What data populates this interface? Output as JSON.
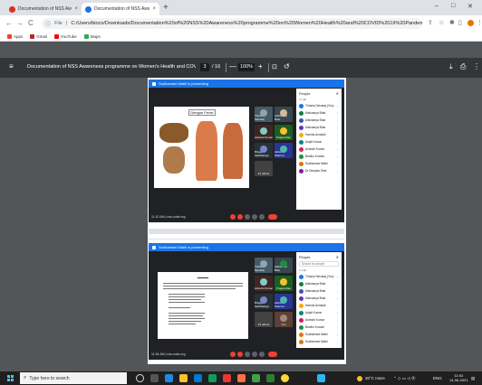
{
  "browser": {
    "tabs": [
      {
        "title": "Documentation of NSS Awarene",
        "favicon_color": "#d93025"
      },
      {
        "title": "Documentation of NSS Awaren",
        "favicon_color": "#1a73e8"
      }
    ],
    "new_tab": "+",
    "window_controls": {
      "minimize": "–",
      "maximize": "□",
      "close": "✕"
    },
    "nav": {
      "back": "←",
      "forward": "→",
      "reload": "C"
    },
    "address": {
      "scheme": "File",
      "url": "C:/Users/bioco/Downloads/Documentation%20of%20NSS%20Awareness%20programme%20on%20Women%20Health%20and%20COVID%2019%20Pandemic.pdf"
    },
    "bookmarks": [
      {
        "label": "Apps",
        "color": "#ea4335"
      },
      {
        "label": "Gmail",
        "color": "#c5221f"
      },
      {
        "label": "YouTube",
        "color": "#ff0000"
      },
      {
        "label": "Maps",
        "color": "#34a853"
      }
    ]
  },
  "pdf_viewer": {
    "title": "Documentation of NSS Awareness programme on Women's Health and COVID 19 Pa...",
    "current_page": "3",
    "total_pages": "/ 16",
    "zoom": "100%",
    "zoom_out": "—",
    "zoom_in": "+"
  },
  "page_content": {
    "shot1": {
      "presenting": "Sudhamani Mathi is presenting",
      "slide_title": "Dengue Fever",
      "meeting_time": "11:10 AM | nss-xoke-nrg",
      "people_header": "People",
      "in_call": "In call",
      "participants": [
        {
          "name": "Thrisha Selvaraj (You)",
          "color": "#1a73e8"
        },
        {
          "name": "Aishwarya Bhat",
          "color": "#0b8043"
        },
        {
          "name": "Aishwarya Bhat",
          "color": "#3f51b5"
        },
        {
          "name": "Aishwarya Bhat",
          "color": "#5e35b1"
        },
        {
          "name": "Harsha Annaiah",
          "color": "#f9ab00"
        },
        {
          "name": "Anjali Kumar",
          "color": "#00897b"
        },
        {
          "name": "Ashwini Kumar",
          "color": "#d81b60"
        },
        {
          "name": "Bindhu Kumari",
          "color": "#1e8e3e"
        },
        {
          "name": "Sudhamani Mathi",
          "color": "#e37400"
        },
        {
          "name": "Dr Deepika Shet",
          "color": "#7b1fa2"
        }
      ],
      "tiles": [
        {
          "name": "Thrisha Selvaraj",
          "color": "#455a64"
        },
        {
          "name": "Aishwarya Bhat",
          "color": "#37474f"
        },
        {
          "name": "Ashwini Kumar",
          "color": "#3e2723"
        },
        {
          "name": "Pragna Rao",
          "color": "#1b5e20"
        },
        {
          "name": "Bhagya Siddhalinga",
          "color": "#263238"
        },
        {
          "name": "Ashwini Sharma",
          "color": "#283593"
        },
        {
          "name": "21 others",
          "color": "#424242"
        }
      ]
    },
    "shot2": {
      "presenting": "Sudhamani Mathi is presenting",
      "meeting_time": "11:34 AM | nss-xoke-nrg",
      "people_header": "People",
      "search_placeholder": "Search for people",
      "in_call": "In call",
      "participants": [
        {
          "name": "Thrisha Selvaraj (You)",
          "color": "#1a73e8"
        },
        {
          "name": "Aishwarya Bhat",
          "color": "#0b8043"
        },
        {
          "name": "Aishwarya Bhat",
          "color": "#3f51b5"
        },
        {
          "name": "Aishwarya Bhat",
          "color": "#5e35b1"
        },
        {
          "name": "Harsha Annaiah",
          "color": "#f9ab00"
        },
        {
          "name": "Anjali Kumar",
          "color": "#00897b"
        },
        {
          "name": "Ashwini Kumar",
          "color": "#d81b60"
        },
        {
          "name": "Bindhu Kumari",
          "color": "#1e8e3e"
        },
        {
          "name": "Sudhamani Mathi",
          "color": "#e37400"
        },
        {
          "name": "Sudhamani Mathi",
          "color": "#e37400"
        }
      ],
      "tiles": [
        {
          "name": "Thrisha Selvaraj",
          "color": "#455a64"
        },
        {
          "name": "Aishwarya Bhat",
          "color": "#37474f"
        },
        {
          "name": "Ashwini Kumar",
          "color": "#3e2723"
        },
        {
          "name": "Pragna Rao",
          "color": "#1b5e20"
        },
        {
          "name": "Bhagya Siddhalinga",
          "color": "#263238"
        },
        {
          "name": "Ashwini Sharma",
          "color": "#283593"
        },
        {
          "name": "21 others",
          "color": "#424242"
        },
        {
          "name": "You",
          "color": "#5d4037"
        }
      ]
    }
  },
  "taskbar": {
    "search_placeholder": "Type here to search",
    "weather": "30°C Haze",
    "lang": "ENG",
    "time": "11:53",
    "date": "14-06-2021"
  }
}
